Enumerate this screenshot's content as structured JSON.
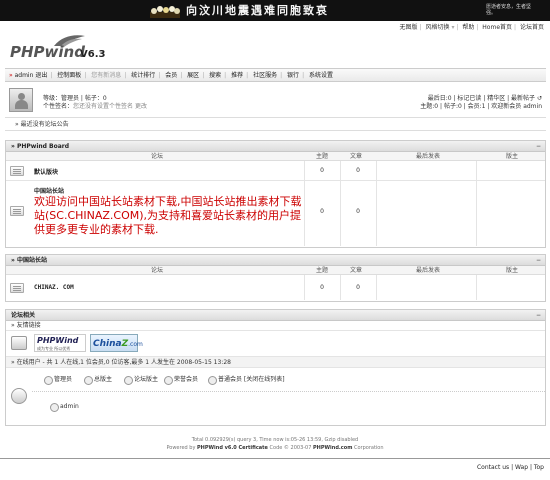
{
  "banner": {
    "title": "向汶川地震遇难同胞致哀",
    "sub": "愿逝者安息，生者坚强。"
  },
  "toplinks": [
    "无图版",
    "风格切换",
    "帮助",
    "Home首页",
    "论坛首页"
  ],
  "logo": {
    "word": "PHPwind",
    "version": "V6.3"
  },
  "nav": {
    "user": "admin",
    "items": [
      {
        "label": "退出",
        "dis": false
      },
      {
        "label": "控制面板",
        "dis": false
      },
      {
        "label": "您有新消息",
        "dis": true
      },
      {
        "label": "统计排行",
        "dis": false
      },
      {
        "label": "会员",
        "dis": false
      },
      {
        "label": "展区",
        "dis": false
      },
      {
        "label": "搜索",
        "dis": false
      },
      {
        "label": "推荐",
        "dis": false
      },
      {
        "label": "社区服务",
        "dis": false
      },
      {
        "label": "银行",
        "dis": false
      },
      {
        "label": "系统设置",
        "dis": false
      }
    ]
  },
  "userinfo": {
    "line1": "等级：管理员 | 帖子：0",
    "line2": "个性签名：",
    "line2_gray": "您还没有设置个性签名",
    "line2_link": "更改",
    "right1": "最后日:0 | 标记已读 | 精华区 | 最新帖子 ↺",
    "right2": "主题:0 | 帖子:0 | 会员:1 | 欢迎新会员 admin"
  },
  "notice": "» 最近没有论坛公告",
  "cols": {
    "forum": "论坛",
    "topics": "主题",
    "posts": "文章",
    "last": "最后发表",
    "mods": "版主"
  },
  "section1": {
    "title": "» PHPwind Board",
    "forums": [
      {
        "name": "默认版块",
        "topics": "0",
        "posts": "0"
      },
      {
        "name": "中国站长站",
        "desc": "欢迎访问中国站长站素材下载,中国站长站推出素材下载站(SC.CHINAZ.COM),为支持和喜爱站长素材的用户提供更多更专业的素材下载.",
        "topics": "0",
        "posts": "0"
      }
    ]
  },
  "section2": {
    "title": "» 中国站长站",
    "forums": [
      {
        "name": "CHINAZ. COM",
        "topics": "0",
        "posts": "0"
      }
    ]
  },
  "section3": {
    "title": "论坛相关",
    "links_title": "» 友情链接",
    "logo1": "PHPWind",
    "logo1_sub": "成为专业 所以优秀",
    "logo2": "China",
    "logo2_b": "Z",
    "logo2_c": ".com",
    "online_text": "» 在线用户 - 共 1 人在线,1 位会员,0 位访客,最多 1 人发生在 2008-05-15 13:28",
    "legend": [
      "管理员",
      "总版主",
      "论坛版主",
      "荣誉会员",
      "普通会员 [关闭在线列表]"
    ],
    "online_user": "admin"
  },
  "footer": {
    "line1": "Total 0.092929(s) query 3, Time now is:05-26 13:59, Gzip disabled",
    "line2_a": "Powered by",
    "line2_b": "PHPWind v6.0 Certificate",
    "line2_c": "Code © 2003-07",
    "line2_d": "PHPWind.com",
    "line2_e": "Corporation"
  },
  "bottom_links": "Contact us | Wap | Top",
  "colors": {
    "banner": "#111111",
    "accent_red": "#cc0000",
    "header_bg": "#dcdcdc"
  }
}
